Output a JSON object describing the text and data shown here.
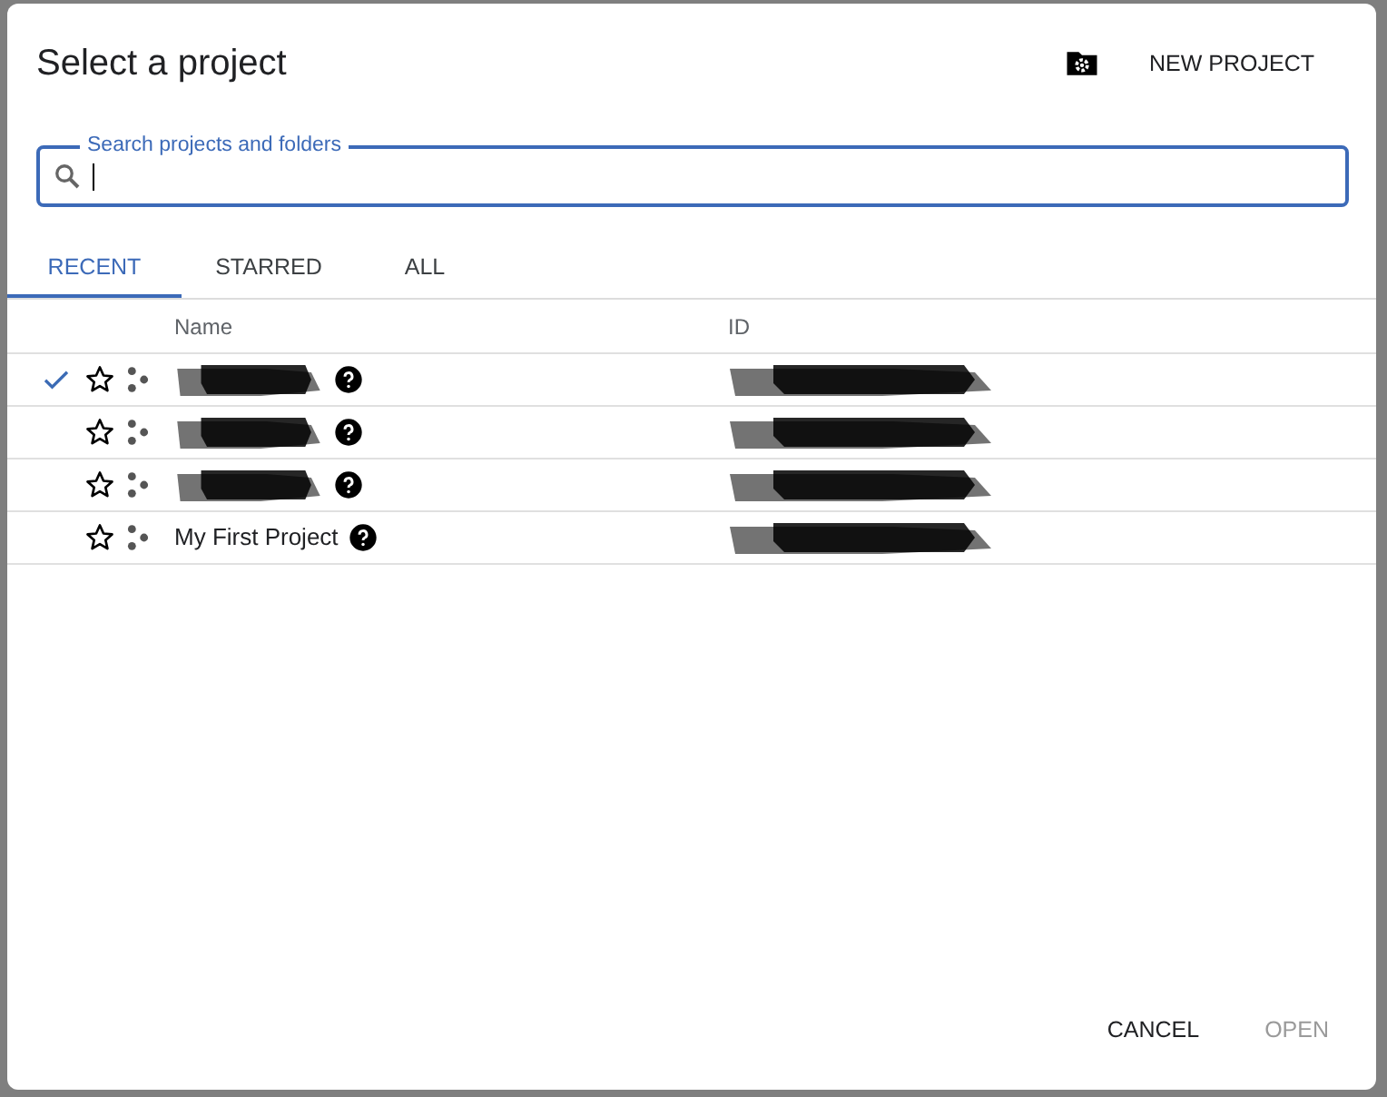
{
  "dialog": {
    "title": "Select a project",
    "new_project_button": "NEW PROJECT"
  },
  "search": {
    "label": "Search projects and folders"
  },
  "tabs": [
    {
      "label": "RECENT",
      "selected": true
    },
    {
      "label": "STARRED",
      "selected": false
    },
    {
      "label": "ALL",
      "selected": false
    }
  ],
  "table": {
    "columns": [
      "Name",
      "ID"
    ],
    "rows": [
      {
        "name_redacted": true,
        "id_redacted": true,
        "selected": true,
        "starred": false
      },
      {
        "name_redacted": true,
        "id_redacted": true,
        "selected": false,
        "starred": false
      },
      {
        "name_redacted": true,
        "id_redacted": true,
        "selected": false,
        "starred": false
      },
      {
        "name": "My First Project",
        "name_redacted": false,
        "id_redacted": true,
        "selected": false,
        "starred": false
      }
    ]
  },
  "buttons": [
    {
      "label": "CANCEL",
      "disabled": false
    },
    {
      "label": "OPEN",
      "disabled": true
    }
  ]
}
